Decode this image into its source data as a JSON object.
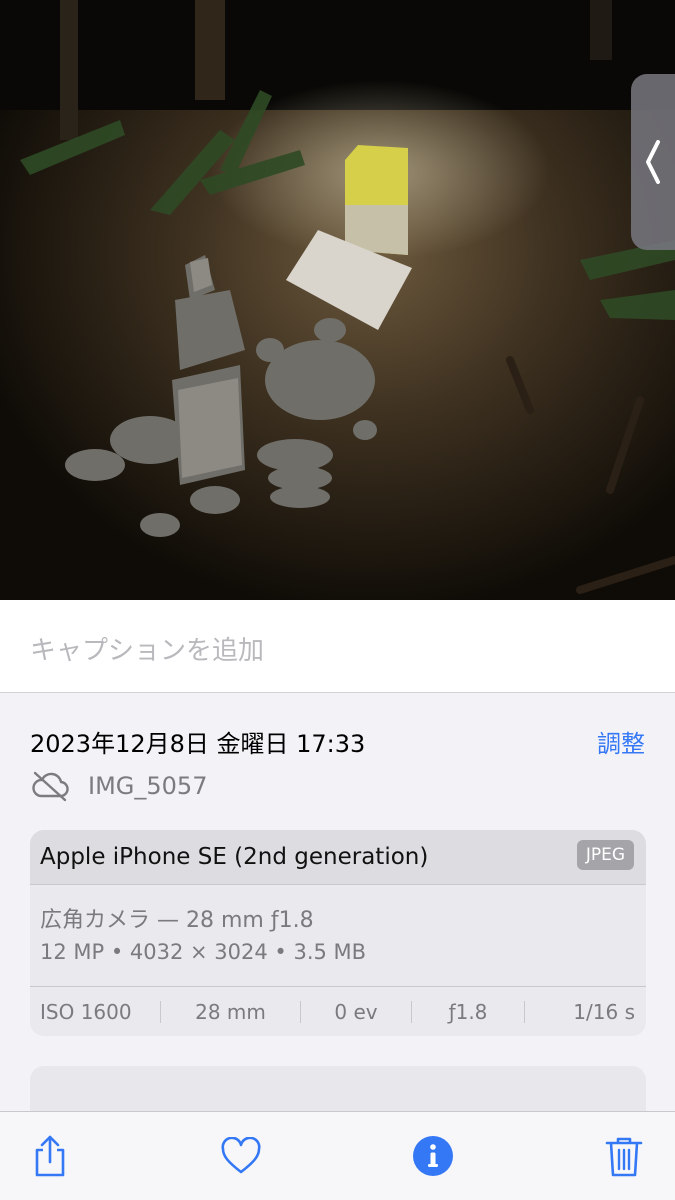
{
  "caption": {
    "placeholder": "キャプションを追加"
  },
  "info": {
    "datetime": "2023年12月8日 金曜日 17:33",
    "adjust_label": "調整",
    "filename": "IMG_5057",
    "file_icon": "cloud-slash-icon"
  },
  "camera": {
    "device": "Apple iPhone SE (2nd generation)",
    "format": "JPEG",
    "lens": "広角カメラ — 28 mm ƒ1.8",
    "specs": "12 MP  •  4032 × 3024  •  3.5 MB",
    "exif": {
      "iso": "ISO 1600",
      "focal": "28 mm",
      "ev": "0 ev",
      "aperture": "ƒ1.8",
      "shutter": "1/16 s"
    }
  },
  "toolbar": {
    "icons": [
      "share-icon",
      "heart-icon",
      "info-icon",
      "trash-icon"
    ],
    "accent": "#3478f6"
  }
}
